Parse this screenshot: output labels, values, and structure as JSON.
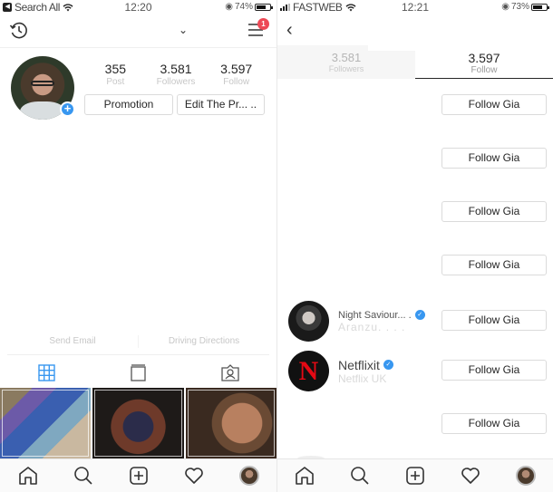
{
  "left_screen": {
    "status": {
      "app_back": "Search All",
      "time": "12:20",
      "battery": "74%"
    },
    "nav": {
      "notification_count": "1"
    },
    "stats": [
      {
        "value": "355",
        "label": "Post"
      },
      {
        "value": "3.581",
        "label": "Followers"
      },
      {
        "value": "3.597",
        "label": "Follow"
      }
    ],
    "buttons": {
      "promotion": "Promotion",
      "edit_profile": "Edit The Pr... .."
    },
    "contact": {
      "email": "Send Email",
      "directions": "Driving Directions"
    },
    "tabs": [
      "grid-icon",
      "feed-icon",
      "tagged-icon"
    ],
    "accent": "#3897f0"
  },
  "right_screen": {
    "status": {
      "carrier": "FASTWEB",
      "time": "12:21",
      "battery": "73%"
    },
    "tabs": [
      {
        "value": "3.581",
        "label": "Followers",
        "active": false
      },
      {
        "value": "3.597",
        "label": "Follow",
        "active": true
      }
    ],
    "follow_label": "Follow Gia",
    "users": [
      {
        "name": "Night Saviour... .",
        "sub": "Aranzu. . . .",
        "verified": true
      },
      {
        "name": "Netflixit",
        "sub": "Netflix UK",
        "verified": true
      }
    ]
  },
  "bottom_nav": [
    "home-icon",
    "search-icon",
    "add-post-icon",
    "activity-heart-icon",
    "profile-avatar"
  ]
}
